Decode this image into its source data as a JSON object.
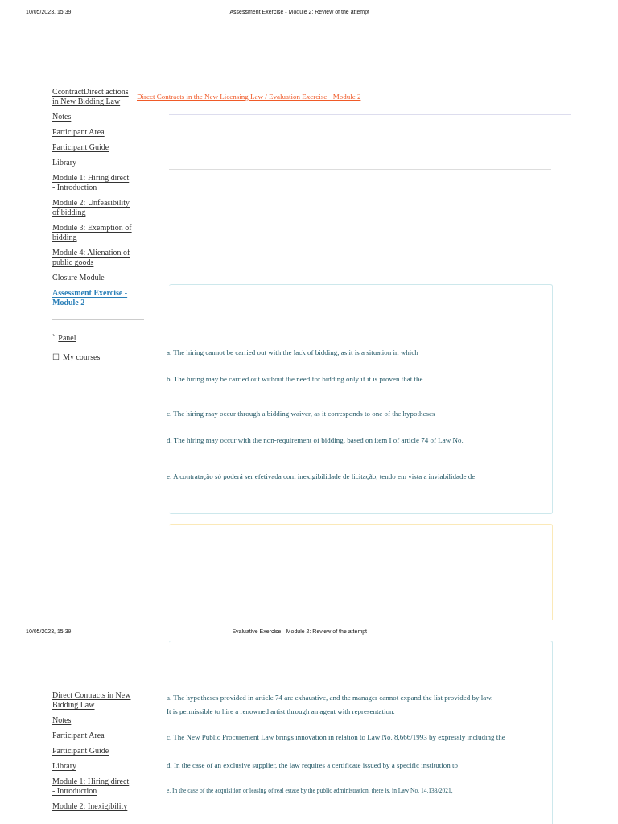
{
  "pages": [
    {
      "header": {
        "date": "10/05/2023, 15:39",
        "title": "Assessment Exercise - Module 2: Review of the attempt"
      },
      "breadcrumb": "Direct Contracts in the New Licensing Law / Evaluation Exercise - Module 2",
      "sidebar": {
        "items": [
          {
            "label": "CcontractDirect actions in New Bidding Law",
            "selected": false
          },
          {
            "label": "Notes",
            "selected": false
          },
          {
            "label": "Participant Area",
            "selected": false
          },
          {
            "label": "Participant Guide",
            "selected": false
          },
          {
            "label": "Library",
            "selected": false
          },
          {
            "label": "Module 1: Hiring direct - Introduction",
            "selected": false
          },
          {
            "label": "Module 2: Unfeasibility of bidding",
            "selected": false
          },
          {
            "label": "Module 3: Exemption of bidding",
            "selected": false
          },
          {
            "label": "Module 4: Alienation of public goods",
            "selected": false
          },
          {
            "label": "Closure Module",
            "selected": false
          },
          {
            "label": "Assessment Exercise - Module 2",
            "selected": true
          }
        ],
        "links": [
          {
            "icon": "ˋ",
            "label": "Panel"
          },
          {
            "icon": "☐",
            "label": "My courses"
          }
        ]
      },
      "options": [
        "a. The hiring cannot be carried out with the lack of bidding, as it is a situation in which",
        "b. The hiring may be carried out without the need for bidding only if it is proven that the",
        "c. The hiring may occur through a bidding waiver, as it corresponds to one of the hypotheses",
        "d. The hiring may occur with the non-requirement of bidding, based on item I of article 74 of Law No.",
        "e. A contratação só poderá ser efetivada com inexigibilidade de licitação, tendo em vista a inviabilidade de"
      ]
    },
    {
      "header": {
        "date": "10/05/2023, 15:39",
        "title": "Evaluative Exercise - Module 2: Review of the attempt"
      },
      "sidebar": {
        "items": [
          {
            "label": "Direct Contracts in New Bidding Law",
            "selected": false
          },
          {
            "label": "Notes",
            "selected": false
          },
          {
            "label": "Participant Area",
            "selected": false
          },
          {
            "label": "Participant Guide",
            "selected": false
          },
          {
            "label": "Library",
            "selected": false
          },
          {
            "label": "Module 1: Hiring direct - Introduction",
            "selected": false
          },
          {
            "label": "Module 2: Inexigibility",
            "selected": false
          }
        ]
      },
      "options": [
        "a. The hypotheses provided in article 74 are exhaustive, and the manager cannot expand the list provided by law.",
        "It is permissible to hire a renowned artist through an agent with representation.",
        "c. The New Public Procurement Law brings innovation in relation to Law No. 8,666/1993 by expressly including the",
        "d. In the case of an exclusive supplier, the law requires a certificate issued by a specific institution to",
        "e. In the case of the acquisition or leasing of real estate by the public administration, there is, in Law No. 14.133/2021,"
      ]
    }
  ]
}
